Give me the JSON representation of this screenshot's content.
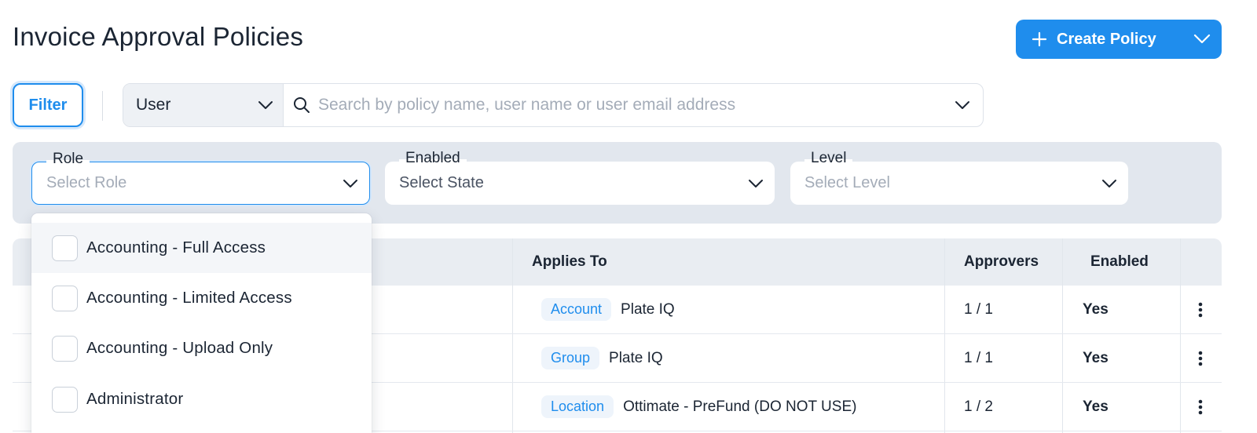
{
  "page": {
    "title": "Invoice Approval Policies"
  },
  "header": {
    "create_label": "Create Policy",
    "accent_color": "#1f8ded"
  },
  "toolbar": {
    "filter_label": "Filter",
    "scope_selected": "User",
    "search_placeholder": "Search by policy name, user name or user email address"
  },
  "filters": {
    "role": {
      "label": "Role",
      "placeholder": "Select Role"
    },
    "enabled": {
      "label": "Enabled",
      "placeholder": "Select State"
    },
    "level": {
      "label": "Level",
      "placeholder": "Select Level"
    }
  },
  "role_options": [
    {
      "label": "Accounting - Full Access",
      "checked": false
    },
    {
      "label": "Accounting - Limited Access",
      "checked": false
    },
    {
      "label": "Accounting - Upload Only",
      "checked": false
    },
    {
      "label": "Administrator",
      "checked": false
    }
  ],
  "table": {
    "columns": [
      "Applies To",
      "Approvers",
      "Enabled"
    ],
    "rows": [
      {
        "type": "Account",
        "target": "Plate IQ",
        "approvers": "1 / 1",
        "enabled": "Yes"
      },
      {
        "type": "Group",
        "target": "Plate IQ",
        "approvers": "1 / 1",
        "enabled": "Yes"
      },
      {
        "type": "Location",
        "target": "Ottimate - PreFund (DO NOT USE)",
        "approvers": "1 / 2",
        "enabled": "Yes"
      }
    ]
  },
  "icons": {
    "plus": "plus-icon",
    "chevron": "chevron-down-icon",
    "search": "search-icon",
    "more": "more-vertical-icon"
  }
}
